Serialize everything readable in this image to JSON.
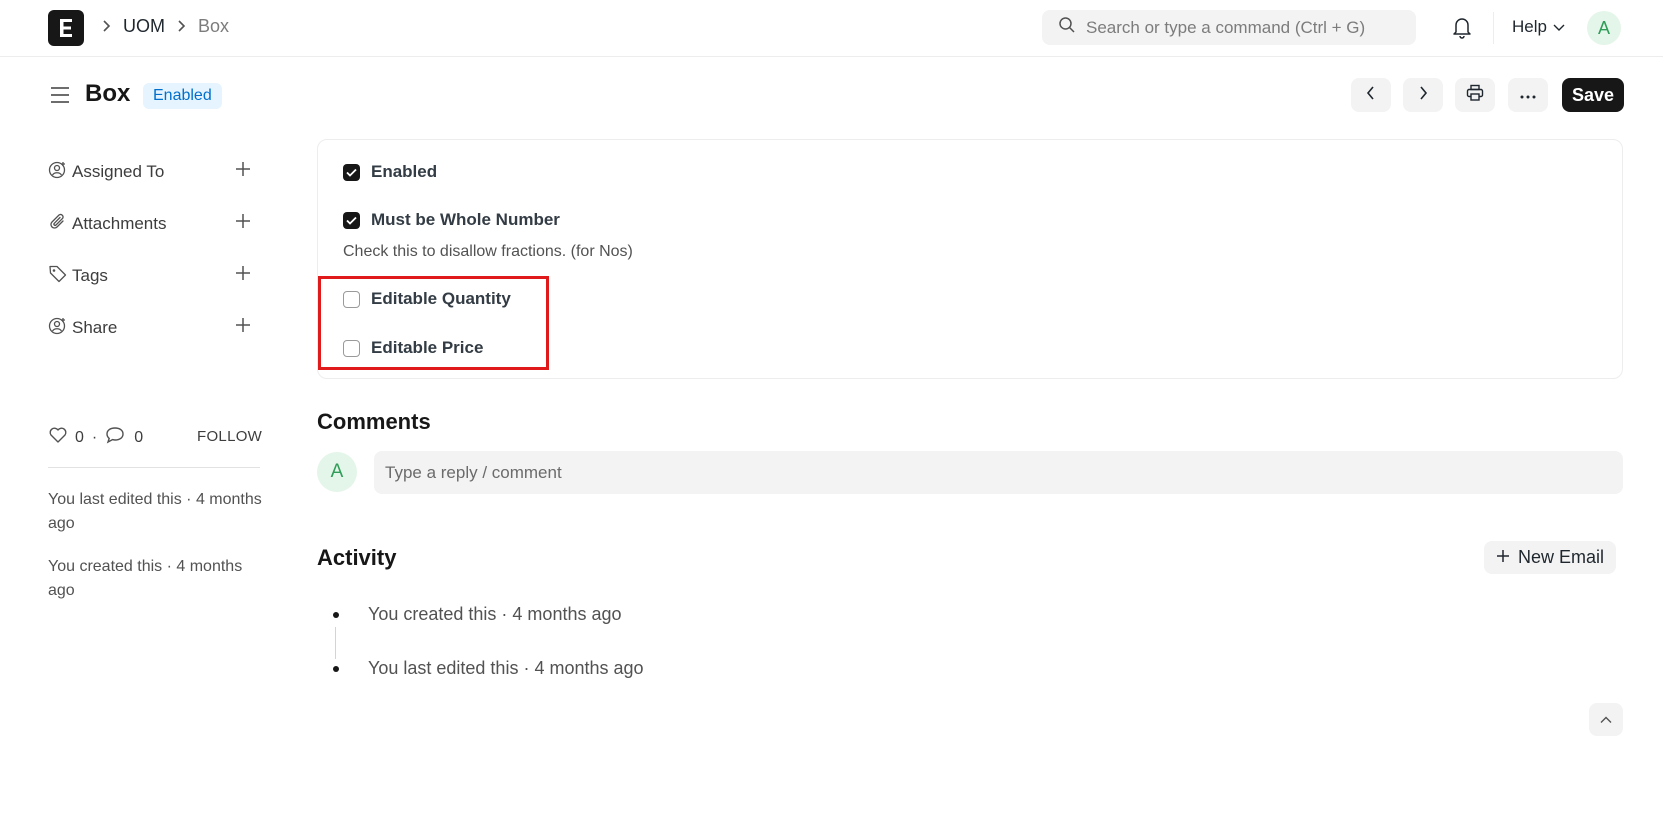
{
  "navbar": {
    "breadcrumbs": [
      "UOM",
      "Box"
    ],
    "search_placeholder": "Search or type a command (Ctrl + G)",
    "help_label": "Help",
    "avatar_initial": "A"
  },
  "page": {
    "title": "Box",
    "status": "Enabled",
    "save_label": "Save"
  },
  "sidebar": {
    "items": [
      {
        "label": "Assigned To",
        "icon": "user-plus-icon"
      },
      {
        "label": "Attachments",
        "icon": "paperclip-icon"
      },
      {
        "label": "Tags",
        "icon": "tag-icon"
      },
      {
        "label": "Share",
        "icon": "share-user-icon"
      }
    ],
    "likes": "0",
    "comments": "0",
    "follow_label": "FOLLOW",
    "last_edited": "You last edited this · 4 months ago",
    "created": "You created this · 4 months ago"
  },
  "form": {
    "enabled": {
      "label": "Enabled",
      "checked": true
    },
    "whole_number": {
      "label": "Must be Whole Number",
      "checked": true
    },
    "whole_number_help": "Check this to disallow fractions. (for Nos)",
    "editable_quantity": {
      "label": "Editable Quantity",
      "checked": false
    },
    "editable_price": {
      "label": "Editable Price",
      "checked": false
    }
  },
  "comments": {
    "heading": "Comments",
    "avatar_initial": "A",
    "placeholder": "Type a reply / comment"
  },
  "activity": {
    "heading": "Activity",
    "new_email_label": "New Email",
    "items": [
      "You created this · 4 months ago",
      "You last edited this · 4 months ago"
    ]
  },
  "colors": {
    "accent": "#171717",
    "status_bg": "#e6f4ff",
    "status_text": "#0070cc",
    "highlight": "#e01a1a"
  }
}
